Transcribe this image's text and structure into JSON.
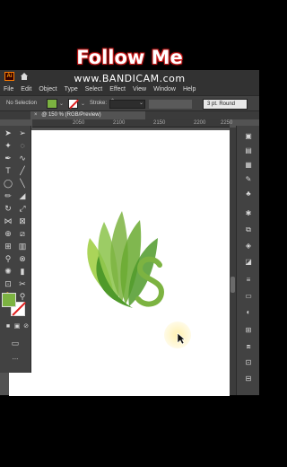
{
  "overlay": {
    "title": "Follow Me",
    "watermark": "www.BANDICAM.com"
  },
  "titlebar": {
    "app_logo": "Ai",
    "home_icon": "home-icon"
  },
  "menu": [
    "File",
    "Edit",
    "Object",
    "Type",
    "Select",
    "Effect",
    "View",
    "Window",
    "Help"
  ],
  "control_bar": {
    "selection_label": "No Selection",
    "fill_color": "#7cb341",
    "stroke_label": "Stroke:",
    "brush_value": "3 pt. Round"
  },
  "document_tab": {
    "title": "@ 150 % (RGB/Preview)",
    "close_glyph": "×"
  },
  "ruler": {
    "ticks": [
      "2050",
      "2100",
      "2150",
      "2200",
      "2250"
    ]
  },
  "tools": {
    "fill_color": "#7cb341",
    "stroke_color": "#ffffff",
    "more_label": "..."
  },
  "colors": {
    "logo_light": "#9ccc3c",
    "logo_mid": "#7cb341",
    "logo_dark": "#4f9a2a"
  }
}
